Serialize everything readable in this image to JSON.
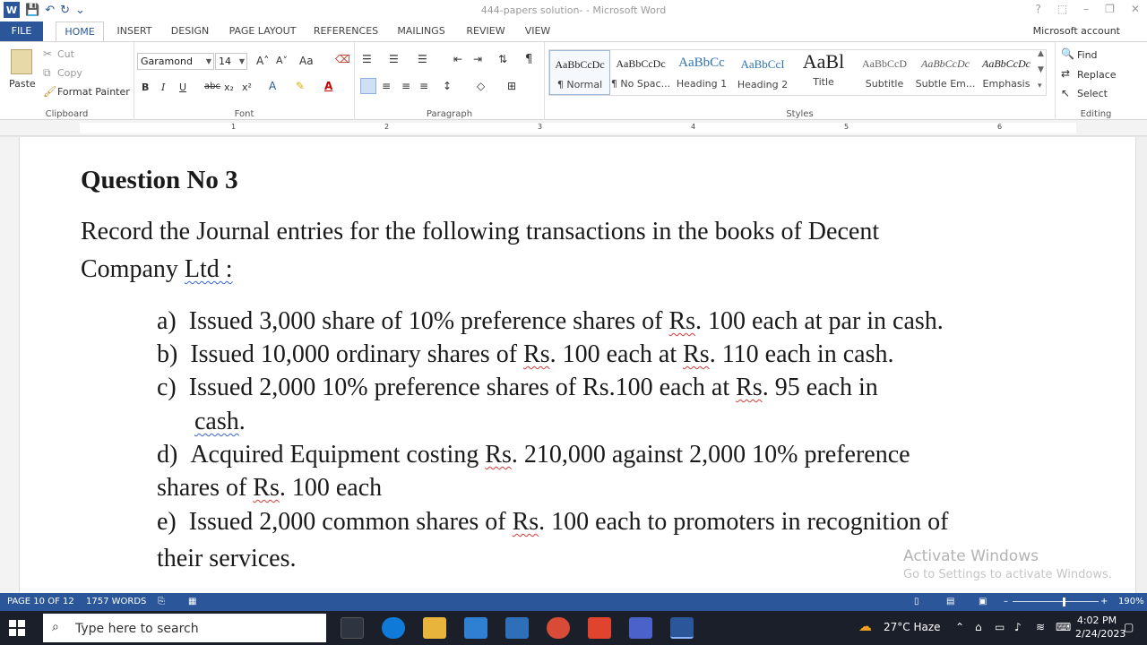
{
  "window": {
    "title": "444-papers solution- - Microsoft Word",
    "help": "?",
    "ribbon_options": "⬚",
    "minimize": "–",
    "restore": "❐",
    "close": "✕"
  },
  "qat": {
    "word_logo": "W",
    "save": "💾",
    "undo": "↶",
    "redo": "↻",
    "customize": "⌄"
  },
  "tabs": {
    "file": "FILE",
    "items": [
      "HOME",
      "INSERT",
      "DESIGN",
      "PAGE LAYOUT",
      "REFERENCES",
      "MAILINGS",
      "REVIEW",
      "VIEW"
    ],
    "account": "Microsoft account"
  },
  "clipboard": {
    "label": "Clipboard",
    "paste": "Paste",
    "cut": "Cut",
    "copy": "Copy",
    "format_painter": "Format Painter"
  },
  "font": {
    "label": "Font",
    "name": "Garamond",
    "size": "14",
    "grow": "A˄",
    "shrink": "A˅",
    "change_case": "Aa",
    "bold": "B",
    "italic": "I",
    "underline": "U",
    "strike": "abc",
    "subscript": "x₂",
    "superscript": "x²"
  },
  "paragraph": {
    "label": "Paragraph",
    "pilcrow": "¶"
  },
  "styles": {
    "label": "Styles",
    "items": [
      {
        "preview": "AaBbCcDc",
        "name": "¶ Normal"
      },
      {
        "preview": "AaBbCcDc",
        "name": "¶ No Spac..."
      },
      {
        "preview": "AaBbCc",
        "name": "Heading 1"
      },
      {
        "preview": "AaBbCcI",
        "name": "Heading 2"
      },
      {
        "preview": "AaBl",
        "name": "Title"
      },
      {
        "preview": "AaBbCcD",
        "name": "Subtitle"
      },
      {
        "preview": "AaBbCcDc",
        "name": "Subtle Em..."
      },
      {
        "preview": "AaBbCcDc",
        "name": "Emphasis"
      }
    ]
  },
  "editing": {
    "label": "Editing",
    "find": "Find",
    "replace": "Replace",
    "select": "Select"
  },
  "ruler": {
    "numbers": [
      "1",
      "2",
      "3",
      "4",
      "5",
      "6"
    ]
  },
  "document": {
    "heading": "Question No 3",
    "intro_line1": "Record the Journal entries for the following transactions in the books of Decent",
    "intro_line2_a": "Company ",
    "intro_line2_b": "Ltd :",
    "items": {
      "a": {
        "marker": "a)",
        "t1": "Issued 3,000 share of 10% preference shares of ",
        "rs1": "Rs",
        "t2": ". 100 each at par in cash."
      },
      "b": {
        "marker": "b)",
        "t1": "Issued 10,000 ordinary shares of ",
        "rs1": "Rs",
        "t2": ". 100 each at ",
        "rs2": "Rs",
        "t3": ". 110 each in cash."
      },
      "c": {
        "marker": "c)",
        "t1": "Issued 2,000 10% preference shares of Rs.100 each at ",
        "rs1": "Rs",
        "t2": ". 95 each in",
        "cont_a": "cash",
        "cont_b": "."
      },
      "d": {
        "marker": "d)",
        "t1": "Acquired Equipment costing ",
        "rs1": "Rs",
        "t2": ". 210,000 against 2,000 10% preference",
        "cont_a": "shares of ",
        "cont_rs": "Rs",
        "cont_b": ". 100 each"
      },
      "e": {
        "marker": "e)",
        "t1": "Issued 2,000 common shares of ",
        "rs1": "Rs",
        "t2": ". 100 each to promoters in recognition of",
        "cont_a": "their services."
      }
    }
  },
  "watermark": {
    "line1": "Activate Windows",
    "line2": "Go to Settings to activate Windows."
  },
  "status": {
    "page": "PAGE 10 OF 12",
    "words": "1757 WORDS",
    "zoom_minus": "–",
    "zoom_plus": "+",
    "zoom": "190%"
  },
  "taskbar": {
    "search_placeholder": "Type here to search",
    "weather": "27°C  Haze",
    "time": "4:02 PM",
    "date": "2/24/2023",
    "tray_arrow": "⌃"
  },
  "colors": {
    "word_blue": "#2b579a",
    "taskbar": "#1b1f2a",
    "spell_red": "#d63a3a",
    "grammar_blue": "#3a62d6"
  }
}
